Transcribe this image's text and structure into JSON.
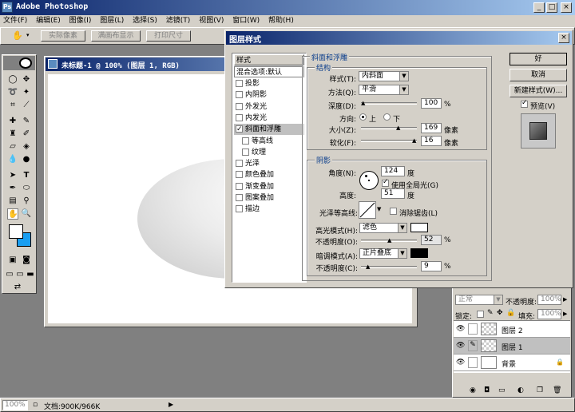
{
  "app": {
    "title": "Adobe Photoshop"
  },
  "menu": [
    "文件(F)",
    "编辑(E)",
    "图像(I)",
    "图层(L)",
    "选择(S)",
    "滤镜(T)",
    "视图(V)",
    "窗口(W)",
    "帮助(H)"
  ],
  "options_bar": {
    "btn1": "实际像素",
    "btn2": "满画布显示",
    "btn3": "打印尺寸"
  },
  "document": {
    "title": "未标题-1 @ 100% (图层 1, RGB)"
  },
  "status": {
    "zoom": "100%",
    "doc_info": "文档:900K/966K"
  },
  "dialog": {
    "title": "图层样式",
    "styles_header": "样式",
    "blend_options": "混合选项:默认",
    "styles": [
      {
        "label": "投影",
        "checked": false,
        "indent": false
      },
      {
        "label": "内阴影",
        "checked": false,
        "indent": false
      },
      {
        "label": "外发光",
        "checked": false,
        "indent": false
      },
      {
        "label": "内发光",
        "checked": false,
        "indent": false
      },
      {
        "label": "斜面和浮雕",
        "checked": true,
        "indent": false
      },
      {
        "label": "等高线",
        "checked": false,
        "indent": true
      },
      {
        "label": "纹理",
        "checked": false,
        "indent": true
      },
      {
        "label": "光泽",
        "checked": false,
        "indent": false
      },
      {
        "label": "颜色叠加",
        "checked": false,
        "indent": false
      },
      {
        "label": "渐变叠加",
        "checked": false,
        "indent": false
      },
      {
        "label": "图案叠加",
        "checked": false,
        "indent": false
      },
      {
        "label": "描边",
        "checked": false,
        "indent": false
      }
    ],
    "section_title": "斜面和浮雕",
    "structure": {
      "title": "结构",
      "style_label": "样式(T):",
      "style_value": "内斜面",
      "technique_label": "方法(Q):",
      "technique_value": "平滑",
      "depth_label": "深度(D):",
      "depth_value": "100",
      "depth_unit": "%",
      "depth_level": 0.0,
      "direction_label": "方向:",
      "direction_up": "上",
      "direction_down": "下",
      "direction_selected": "上",
      "size_label": "大小(Z):",
      "size_value": "169",
      "size_unit": "像素",
      "size_level": 0.68,
      "soften_label": "软化(F):",
      "soften_value": "16",
      "soften_unit": "像素",
      "soften_level": 1.0
    },
    "shading": {
      "title": "阴影",
      "angle_label": "角度(N):",
      "angle_value": "124",
      "angle_unit": "度",
      "global_light_label": "使用全局光(G)",
      "global_light": true,
      "altitude_label": "高度:",
      "altitude_value": "51",
      "altitude_unit": "度",
      "gloss_label": "光泽等高线:",
      "antialias_label": "消除锯齿(L)",
      "antialias": false,
      "highlight_mode_label": "高光模式(H):",
      "highlight_mode_value": "滤色",
      "highlight_color": "#ffffff",
      "highlight_opacity_label": "不透明度(O):",
      "highlight_opacity_value": "52",
      "highlight_opacity_unit": "%",
      "highlight_opacity_level": 0.52,
      "shadow_mode_label": "暗调模式(A):",
      "shadow_mode_value": "正片叠底",
      "shadow_color": "#000000",
      "shadow_opacity_label": "不透明度(C):",
      "shadow_opacity_value": "9",
      "shadow_opacity_unit": "%",
      "shadow_opacity_level": 0.09
    },
    "buttons": {
      "ok": "好",
      "cancel": "取消",
      "new_style": "新建样式(W)...",
      "preview": "预览(V)"
    },
    "preview_checked": true
  },
  "layers_panel": {
    "mode": "正常",
    "opacity_label": "不透明度:",
    "opacity_value": "100%",
    "lock_label": "锁定:",
    "fill_label": "填充:",
    "fill_value": "100%",
    "layers": [
      {
        "name": "图层 2",
        "selected": false
      },
      {
        "name": "图层 1",
        "selected": true
      },
      {
        "name": "背景",
        "selected": false
      }
    ]
  },
  "colors": {
    "titlebar_start": "#0a246a",
    "titlebar_end": "#a6caf0",
    "face": "#d4d0c8",
    "background_swatch": "#1a9ef0"
  }
}
